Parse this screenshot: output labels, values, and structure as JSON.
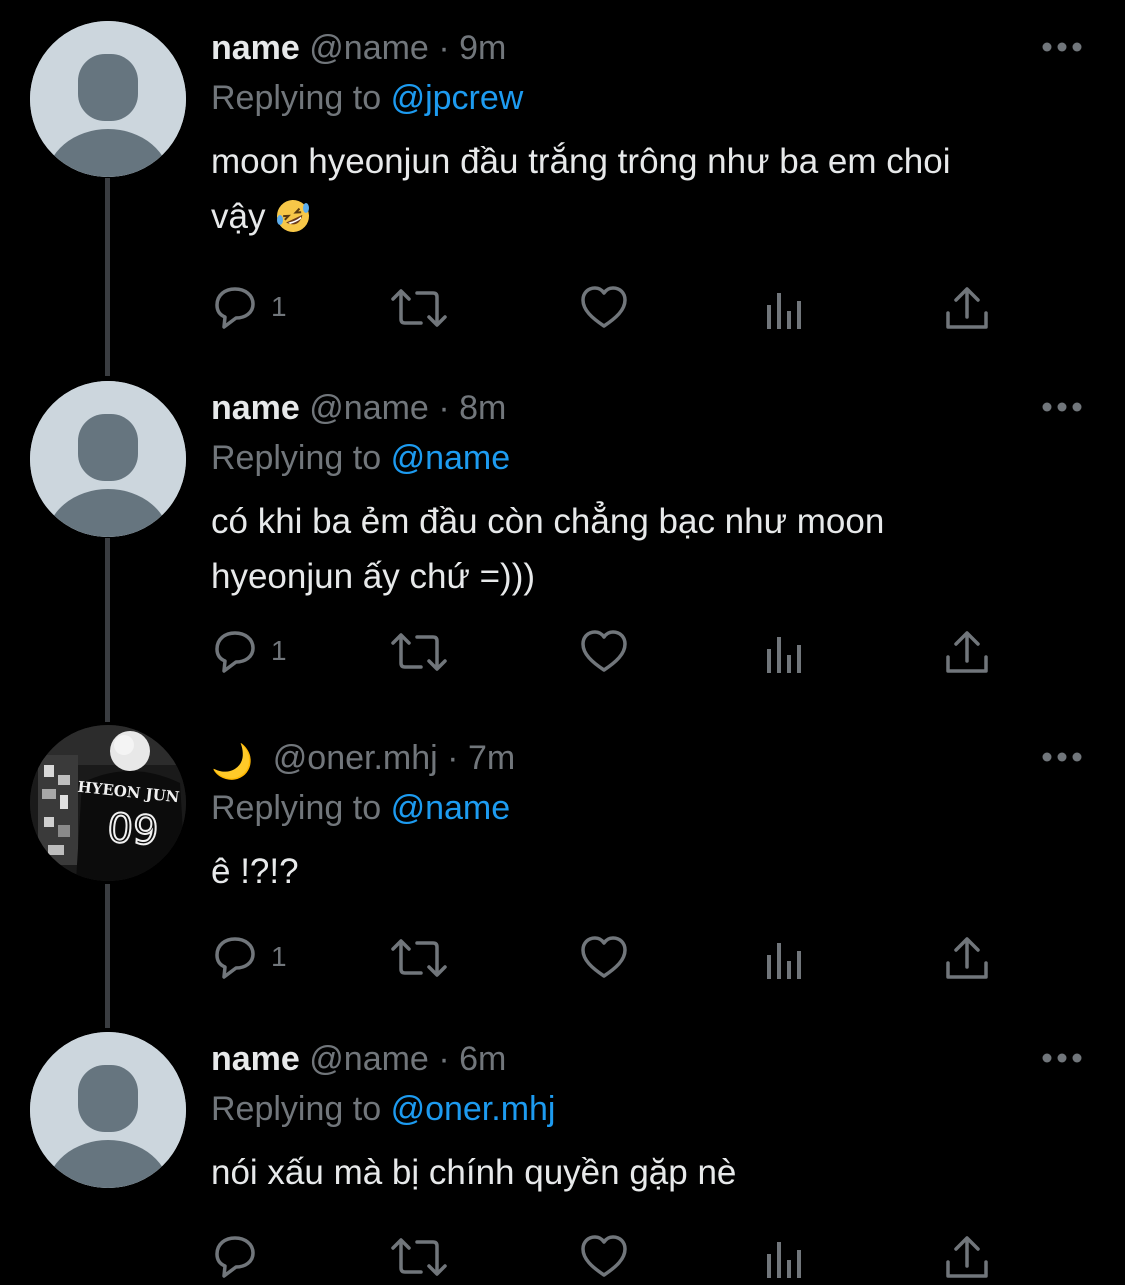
{
  "colors": {
    "background": "#000000",
    "text": "#e7e9ea",
    "secondary": "#71767b",
    "link": "#1d9bf0",
    "thread_line": "#3a3d41",
    "default_avatar_bg": "#ccd6dd",
    "default_avatar_fg": "#66757f"
  },
  "replying_prefix": "Replying to",
  "tweets": [
    {
      "display_name": "name",
      "handle": "@name",
      "separator": "·",
      "time": "9m",
      "replying_to": "@jpcrew",
      "text_line1": "moon hyeonjun đầu trắng trông như ba em choi",
      "text_line2": "vậy",
      "emoji": "rolling-on-floor-laughing",
      "reply_count": "1",
      "avatar": "default-avatar"
    },
    {
      "display_name": "name",
      "handle": "@name",
      "separator": "·",
      "time": "8m",
      "replying_to": "@name",
      "text_line1": "có khi ba ẻm đầu còn chẳng bạc như moon",
      "text_line2": "hyeonjun ấy chứ =)))",
      "reply_count": "1",
      "avatar": "default-avatar"
    },
    {
      "display_name": "🌙",
      "handle": "@oner.mhj",
      "separator": "·",
      "time": "7m",
      "replying_to": "@name",
      "text_line1": "ê !?!?",
      "reply_count": "1",
      "avatar": "photo-avatar",
      "avatar_jersey_text": "HYEON JUN",
      "avatar_jersey_number": "09"
    },
    {
      "display_name": "name",
      "handle": "@name",
      "separator": "·",
      "time": "6m",
      "replying_to": "@oner.mhj",
      "text_line1": "nói xấu mà bị chính quyền gặp nè",
      "reply_count": "",
      "avatar": "default-avatar"
    }
  ],
  "icons": [
    "reply-icon",
    "retweet-icon",
    "like-icon",
    "analytics-icon",
    "share-icon",
    "more-icon"
  ]
}
